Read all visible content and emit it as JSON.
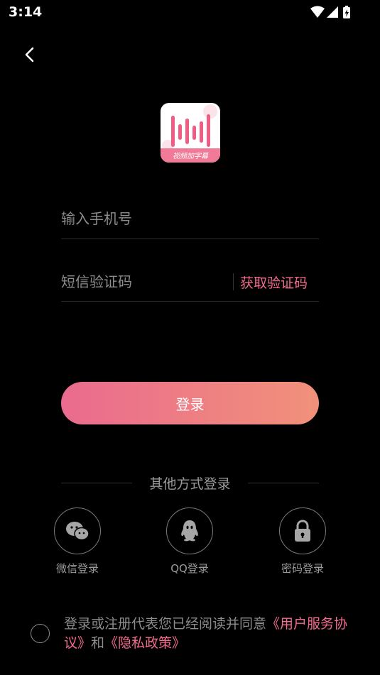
{
  "status": {
    "time": "3:14"
  },
  "logo": {
    "caption": "视频加字幕"
  },
  "form": {
    "phone_placeholder": "输入手机号",
    "code_placeholder": "短信验证码",
    "get_code_label": "获取验证码",
    "login_label": "登录"
  },
  "other": {
    "title": "其他方式登录",
    "methods": [
      {
        "label": "微信登录",
        "icon": "wechat-icon"
      },
      {
        "label": "QQ登录",
        "icon": "qq-icon"
      },
      {
        "label": "密码登录",
        "icon": "lock-icon"
      }
    ]
  },
  "agreement": {
    "prefix": "登录或注册代表您已经阅读并同意",
    "user_link": "《用户服务协议》",
    "middle": "和",
    "privacy_link": "《隐私政策》"
  },
  "colors": {
    "accent": "#f36b8d",
    "gradient_start": "#ea6b8e",
    "gradient_end": "#f1917a",
    "background": "#000000"
  }
}
